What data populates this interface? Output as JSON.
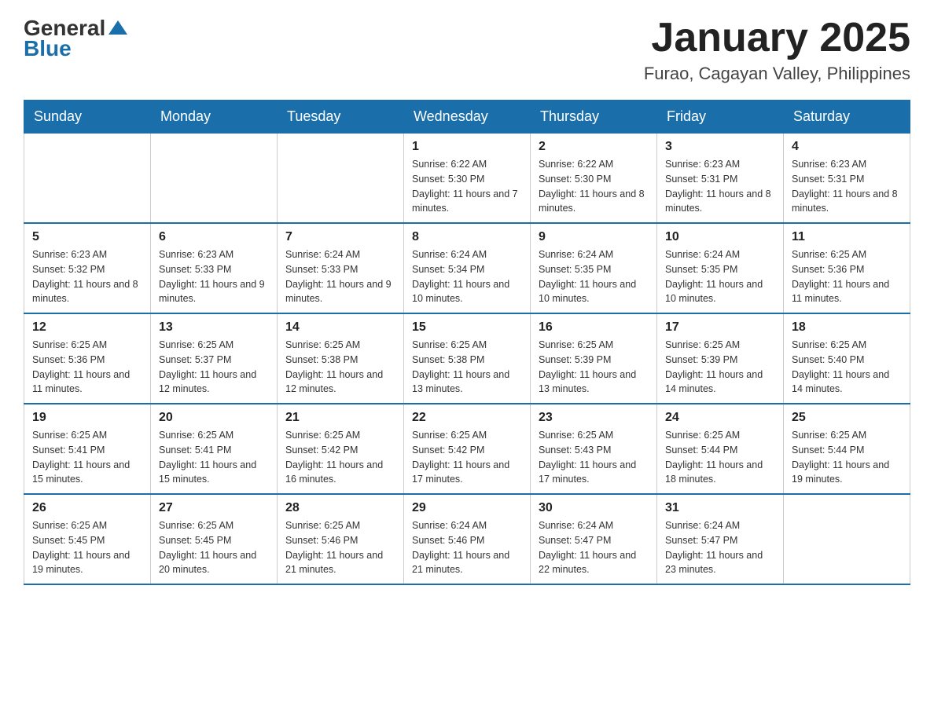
{
  "logo": {
    "general": "General",
    "blue": "Blue"
  },
  "title": {
    "month": "January 2025",
    "location": "Furao, Cagayan Valley, Philippines"
  },
  "weekdays": [
    "Sunday",
    "Monday",
    "Tuesday",
    "Wednesday",
    "Thursday",
    "Friday",
    "Saturday"
  ],
  "weeks": [
    [
      {
        "day": "",
        "info": ""
      },
      {
        "day": "",
        "info": ""
      },
      {
        "day": "",
        "info": ""
      },
      {
        "day": "1",
        "info": "Sunrise: 6:22 AM\nSunset: 5:30 PM\nDaylight: 11 hours and 7 minutes."
      },
      {
        "day": "2",
        "info": "Sunrise: 6:22 AM\nSunset: 5:30 PM\nDaylight: 11 hours and 8 minutes."
      },
      {
        "day": "3",
        "info": "Sunrise: 6:23 AM\nSunset: 5:31 PM\nDaylight: 11 hours and 8 minutes."
      },
      {
        "day": "4",
        "info": "Sunrise: 6:23 AM\nSunset: 5:31 PM\nDaylight: 11 hours and 8 minutes."
      }
    ],
    [
      {
        "day": "5",
        "info": "Sunrise: 6:23 AM\nSunset: 5:32 PM\nDaylight: 11 hours and 8 minutes."
      },
      {
        "day": "6",
        "info": "Sunrise: 6:23 AM\nSunset: 5:33 PM\nDaylight: 11 hours and 9 minutes."
      },
      {
        "day": "7",
        "info": "Sunrise: 6:24 AM\nSunset: 5:33 PM\nDaylight: 11 hours and 9 minutes."
      },
      {
        "day": "8",
        "info": "Sunrise: 6:24 AM\nSunset: 5:34 PM\nDaylight: 11 hours and 10 minutes."
      },
      {
        "day": "9",
        "info": "Sunrise: 6:24 AM\nSunset: 5:35 PM\nDaylight: 11 hours and 10 minutes."
      },
      {
        "day": "10",
        "info": "Sunrise: 6:24 AM\nSunset: 5:35 PM\nDaylight: 11 hours and 10 minutes."
      },
      {
        "day": "11",
        "info": "Sunrise: 6:25 AM\nSunset: 5:36 PM\nDaylight: 11 hours and 11 minutes."
      }
    ],
    [
      {
        "day": "12",
        "info": "Sunrise: 6:25 AM\nSunset: 5:36 PM\nDaylight: 11 hours and 11 minutes."
      },
      {
        "day": "13",
        "info": "Sunrise: 6:25 AM\nSunset: 5:37 PM\nDaylight: 11 hours and 12 minutes."
      },
      {
        "day": "14",
        "info": "Sunrise: 6:25 AM\nSunset: 5:38 PM\nDaylight: 11 hours and 12 minutes."
      },
      {
        "day": "15",
        "info": "Sunrise: 6:25 AM\nSunset: 5:38 PM\nDaylight: 11 hours and 13 minutes."
      },
      {
        "day": "16",
        "info": "Sunrise: 6:25 AM\nSunset: 5:39 PM\nDaylight: 11 hours and 13 minutes."
      },
      {
        "day": "17",
        "info": "Sunrise: 6:25 AM\nSunset: 5:39 PM\nDaylight: 11 hours and 14 minutes."
      },
      {
        "day": "18",
        "info": "Sunrise: 6:25 AM\nSunset: 5:40 PM\nDaylight: 11 hours and 14 minutes."
      }
    ],
    [
      {
        "day": "19",
        "info": "Sunrise: 6:25 AM\nSunset: 5:41 PM\nDaylight: 11 hours and 15 minutes."
      },
      {
        "day": "20",
        "info": "Sunrise: 6:25 AM\nSunset: 5:41 PM\nDaylight: 11 hours and 15 minutes."
      },
      {
        "day": "21",
        "info": "Sunrise: 6:25 AM\nSunset: 5:42 PM\nDaylight: 11 hours and 16 minutes."
      },
      {
        "day": "22",
        "info": "Sunrise: 6:25 AM\nSunset: 5:42 PM\nDaylight: 11 hours and 17 minutes."
      },
      {
        "day": "23",
        "info": "Sunrise: 6:25 AM\nSunset: 5:43 PM\nDaylight: 11 hours and 17 minutes."
      },
      {
        "day": "24",
        "info": "Sunrise: 6:25 AM\nSunset: 5:44 PM\nDaylight: 11 hours and 18 minutes."
      },
      {
        "day": "25",
        "info": "Sunrise: 6:25 AM\nSunset: 5:44 PM\nDaylight: 11 hours and 19 minutes."
      }
    ],
    [
      {
        "day": "26",
        "info": "Sunrise: 6:25 AM\nSunset: 5:45 PM\nDaylight: 11 hours and 19 minutes."
      },
      {
        "day": "27",
        "info": "Sunrise: 6:25 AM\nSunset: 5:45 PM\nDaylight: 11 hours and 20 minutes."
      },
      {
        "day": "28",
        "info": "Sunrise: 6:25 AM\nSunset: 5:46 PM\nDaylight: 11 hours and 21 minutes."
      },
      {
        "day": "29",
        "info": "Sunrise: 6:24 AM\nSunset: 5:46 PM\nDaylight: 11 hours and 21 minutes."
      },
      {
        "day": "30",
        "info": "Sunrise: 6:24 AM\nSunset: 5:47 PM\nDaylight: 11 hours and 22 minutes."
      },
      {
        "day": "31",
        "info": "Sunrise: 6:24 AM\nSunset: 5:47 PM\nDaylight: 11 hours and 23 minutes."
      },
      {
        "day": "",
        "info": ""
      }
    ]
  ]
}
